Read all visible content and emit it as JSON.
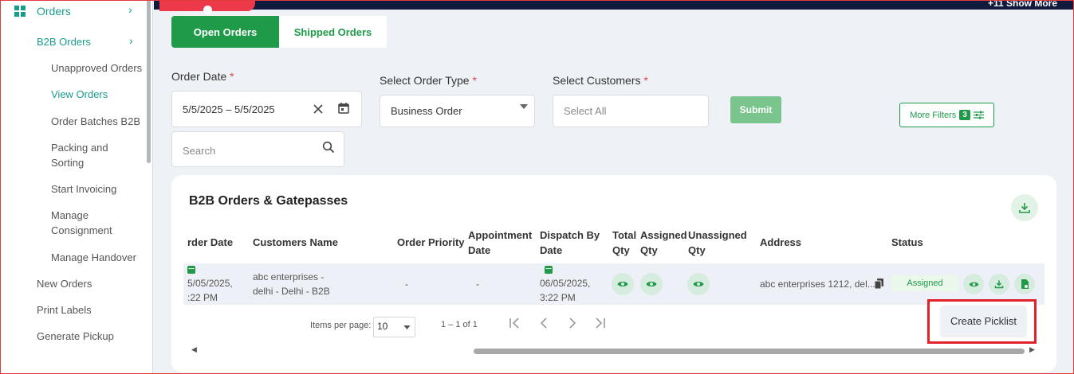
{
  "sidebar": {
    "top_label": "Orders",
    "b2b_label": "B2B Orders",
    "items": [
      {
        "label": "Unapproved Orders"
      },
      {
        "label": "View Orders"
      },
      {
        "label": "Order Batches B2B"
      },
      {
        "label": "Packing and Sorting"
      },
      {
        "label": "Start Invoicing"
      },
      {
        "label": "Manage Consignment"
      },
      {
        "label": "Manage Handover"
      }
    ],
    "main_items": [
      {
        "label": "New Orders"
      },
      {
        "label": "Print Labels"
      },
      {
        "label": "Generate Pickup"
      }
    ]
  },
  "banner": {
    "show_more": "+11 Show More"
  },
  "tabs": {
    "open": "Open Orders",
    "shipped": "Shipped Orders"
  },
  "filters": {
    "order_date_label": "Order Date",
    "order_date_value": "5/5/2025 – 5/5/2025",
    "order_type_label": "Select Order Type",
    "order_type_value": "Business Order",
    "customers_label": "Select Customers",
    "customers_placeholder": "Select All",
    "search_placeholder": "Search",
    "required_mark": "*",
    "submit": "Submit",
    "more_filters": "More Filters",
    "more_filters_count": "3"
  },
  "table": {
    "title": "B2B Orders & Gatepasses",
    "headers": {
      "order_date": "rder Date",
      "customer": "Customers Name",
      "priority": "Order Priority",
      "appointment_1": "Appointment",
      "appointment_2": "Date",
      "dispatch_1": "Dispatch By",
      "dispatch_2": "Date",
      "total_1": "Total",
      "total_2": "Qty",
      "assigned_1": "Assigned",
      "assigned_2": "Qty",
      "unassigned_1": "Unassigned",
      "unassigned_2": "Qty",
      "address": "Address",
      "status": "Status"
    },
    "row": {
      "order_date_1": "5/05/2025,",
      "order_date_2": ":22 PM",
      "customer_1": "abc enterprises -",
      "customer_2": "delhi - Delhi - B2B",
      "priority": "-",
      "appointment": "-",
      "dispatch_1": "06/05/2025,",
      "dispatch_2": "3:22 PM",
      "address": "abc enterprises 1212, del...",
      "status": "Assigned"
    },
    "paginator": {
      "items_per_page": "Items per page:",
      "page_size": "10",
      "range": "1 – 1 of 1"
    }
  },
  "popup": {
    "create_picklist": "Create Picklist"
  },
  "colors": {
    "primary_green": "#1f9a49",
    "teal": "#1a9c8c",
    "highlight_red": "#e1222a"
  }
}
